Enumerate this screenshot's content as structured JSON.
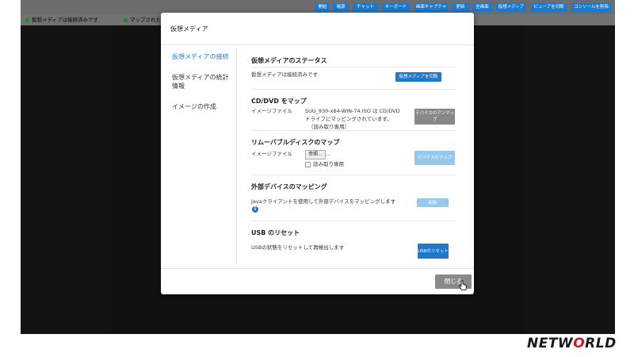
{
  "toolbar": {
    "buttons": [
      "開始",
      "電源",
      "チャット",
      "キーボード",
      "画面キャプチャ",
      "更新",
      "全画面",
      "仮想メディア",
      "ビューアを切断",
      "コンソールを削除"
    ]
  },
  "status_bar": {
    "item1": "仮想メディアは接続済みです",
    "item2": "マップされた"
  },
  "modal": {
    "title": "仮想メディア",
    "nav": [
      "仮想メディアの接続",
      "仮想メディアの統計情報",
      "イメージの作成"
    ],
    "status_section": {
      "title": "仮想メディアのステータス",
      "text": "仮想メディアは接続済みです",
      "disconnect_button": "仮想メディアを切断"
    },
    "cd_section": {
      "title": "CD/DVD をマップ",
      "label": "イメージファイル",
      "value_line1": "SUU_930-x64-WIN-74.ISO は CD/DVD",
      "value_line2": "ドライブにマッピングされています。",
      "value_line3": "（読み取り専用）",
      "unmap_button": "デバイスのアンマップ"
    },
    "removable_section": {
      "title": "リムーバブルディスクのマップ",
      "label": "イメージファイル",
      "browse_button": "参照...",
      "ellipsis": "...",
      "readonly_label": "読み取り専用",
      "map_button": "デバイスのマップ"
    },
    "external_section": {
      "title": "外部デバイスのマッピング",
      "text": "Javaクライアントを使用して外部デバイスをマッピングします",
      "start_button": "起動"
    },
    "usb_section": {
      "title": "USB のリセット",
      "text": "USBの状態をリセットして再検出します",
      "reset_button": "USBのリセット"
    },
    "close_button": "閉じる"
  },
  "brand": {
    "logo_pre": "NETW",
    "logo_o": "O",
    "logo_post": "RLD",
    "accent_color": "#d3142a"
  }
}
